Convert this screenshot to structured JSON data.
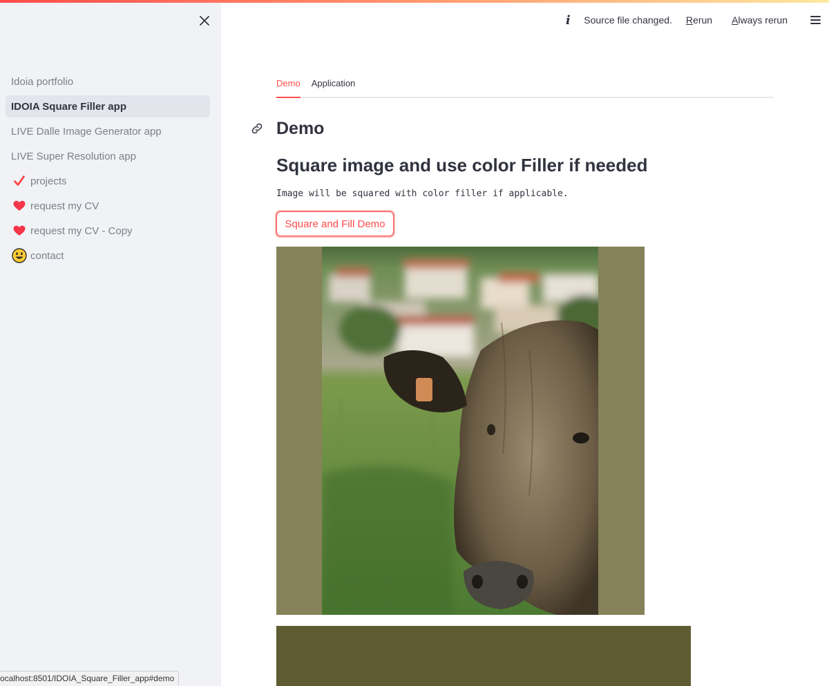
{
  "header": {
    "source_changed": "Source file changed.",
    "rerun_accel": "R",
    "rerun_rest": "erun",
    "always_accel": "A",
    "always_rest": "lways rerun"
  },
  "sidebar": {
    "items": [
      {
        "label": "Idoia portfolio"
      },
      {
        "label": "IDOIA Square Filler app"
      },
      {
        "label": "LIVE Dalle Image Generator app"
      },
      {
        "label": "LIVE Super Resolution app"
      },
      {
        "label": "projects",
        "icon": "checkmark-icon"
      },
      {
        "label": "request my CV",
        "icon": "heart-icon"
      },
      {
        "label": "request my CV - Copy",
        "icon": "heart-icon"
      },
      {
        "label": "contact",
        "icon": "smiley-icon"
      }
    ]
  },
  "status_url": "ocalhost:8501/IDOIA_Square_Filler_app#demo",
  "main": {
    "tabs": [
      {
        "label": "Demo"
      },
      {
        "label": "Application"
      }
    ],
    "heading": "Demo",
    "subheading": "Square image and use color Filler if needed",
    "description": "Image will be squared with color filler if applicable.",
    "button_label": "Square and Fill Demo"
  },
  "colors": {
    "accent": "#ff4b4b",
    "filler_color": "#858259",
    "second_filler": "#5f5b33"
  }
}
